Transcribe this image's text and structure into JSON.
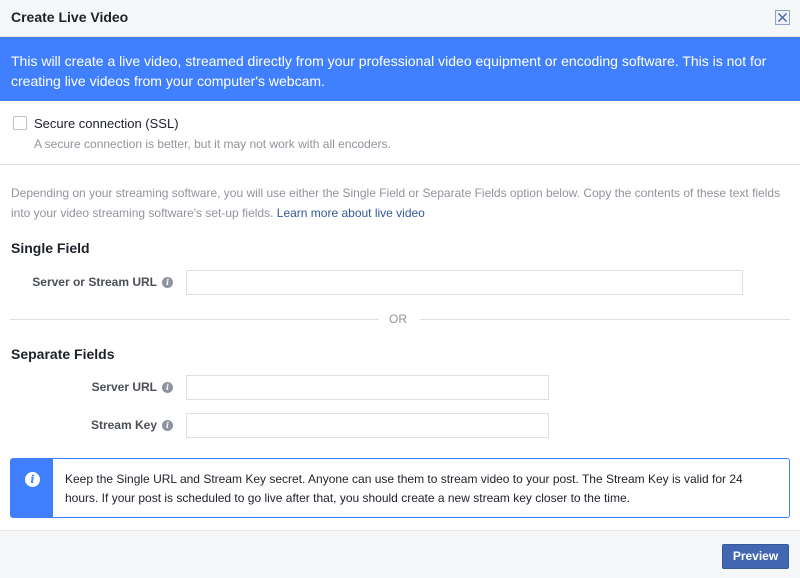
{
  "dialog": {
    "title": "Create Live Video",
    "close_icon": "close-icon"
  },
  "banner": {
    "text": "This will create a live video, streamed directly from your professional video equipment or encoding software. This is not for creating live videos from your computer's webcam."
  },
  "ssl": {
    "checked": false,
    "label": "Secure connection (SSL)",
    "description": "A secure connection is better, but it may not work with all encoders."
  },
  "intro": {
    "text": "Depending on your streaming software, you will use either the Single Field or Separate Fields option below. Copy the contents of these text fields into your video streaming software's set-up fields.",
    "link": "Learn more about live video"
  },
  "single_field": {
    "title": "Single Field",
    "label": "Server or Stream URL",
    "value": ""
  },
  "divider": {
    "text": "OR"
  },
  "separate_fields": {
    "title": "Separate Fields",
    "server_url_label": "Server URL",
    "server_url_value": "",
    "stream_key_label": "Stream Key",
    "stream_key_value": ""
  },
  "notice": {
    "icon": "info-icon",
    "text": "Keep the Single URL and Stream Key secret. Anyone can use them to stream video to your post. The Stream Key is valid for 24 hours. If your post is scheduled to go live after that, you should create a new stream key closer to the time."
  },
  "footer": {
    "preview_label": "Preview"
  },
  "colors": {
    "accent": "#4080ff",
    "button": "#4267b2",
    "link": "#365899"
  }
}
